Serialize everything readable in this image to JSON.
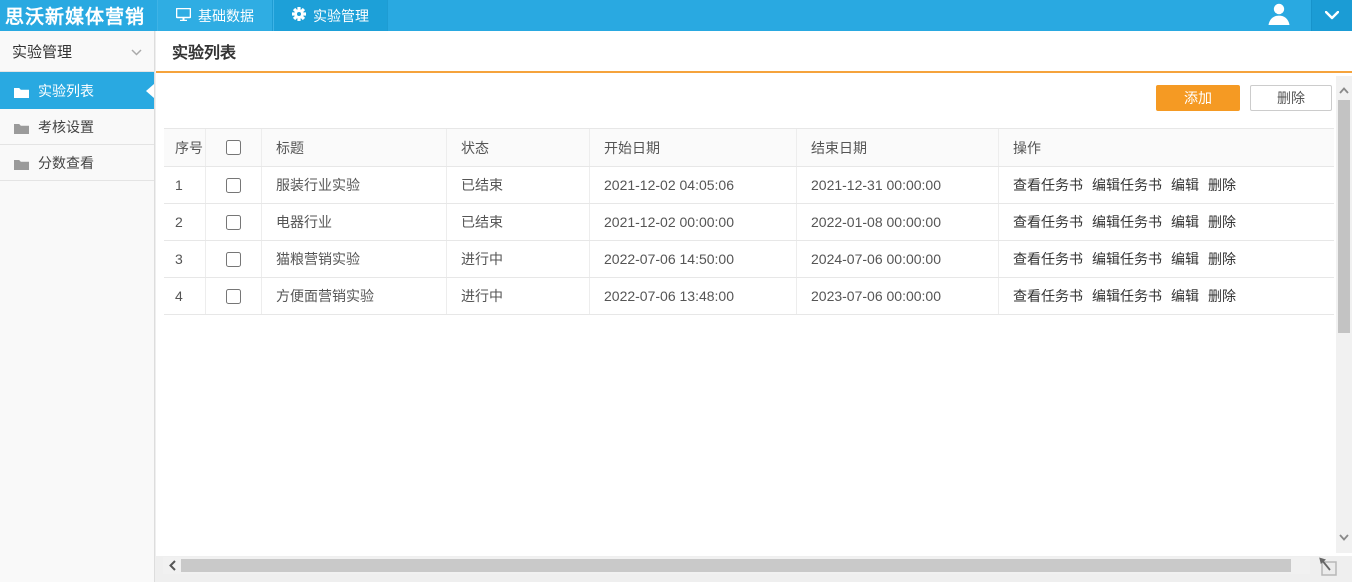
{
  "topbar": {
    "brand": "思沃新媒体营销",
    "tabs": [
      {
        "label": "基础数据",
        "icon": "monitor-icon",
        "active": false
      },
      {
        "label": "实验管理",
        "icon": "gear-icon",
        "active": true
      }
    ]
  },
  "sidebar": {
    "group_label": "实验管理",
    "items": [
      {
        "label": "实验列表",
        "active": true
      },
      {
        "label": "考核设置",
        "active": false
      },
      {
        "label": "分数查看",
        "active": false
      }
    ]
  },
  "main": {
    "title": "实验列表",
    "toolbar": {
      "add_label": "添加",
      "delete_label": "删除"
    },
    "table": {
      "headers": [
        "序号",
        "标题",
        "状态",
        "开始日期",
        "结束日期",
        "操作"
      ],
      "row_actions": [
        {
          "label": "查看任务书",
          "name": "view-task-link"
        },
        {
          "label": "编辑任务书",
          "name": "edit-task-link"
        },
        {
          "label": "编辑",
          "name": "edit-link"
        },
        {
          "label": "删除",
          "name": "delete-link"
        }
      ],
      "rows": [
        {
          "index": "1",
          "title": "服装行业实验",
          "status": "已结束",
          "start": "2021-12-02 04:05:06",
          "end": "2021-12-31 00:00:00"
        },
        {
          "index": "2",
          "title": "电器行业",
          "status": "已结束",
          "start": "2021-12-02 00:00:00",
          "end": "2022-01-08 00:00:00"
        },
        {
          "index": "3",
          "title": "猫粮营销实验",
          "status": "进行中",
          "start": "2022-07-06 14:50:00",
          "end": "2024-07-06 00:00:00"
        },
        {
          "index": "4",
          "title": "方便面营销实验",
          "status": "进行中",
          "start": "2022-07-06 13:48:00",
          "end": "2023-07-06 00:00:00"
        }
      ]
    }
  },
  "colors": {
    "topbar_blue": "#29a9e1",
    "active_tab_blue": "#1da0d8",
    "accent_orange": "#f59a23",
    "title_rule_orange": "#f5a33c"
  }
}
